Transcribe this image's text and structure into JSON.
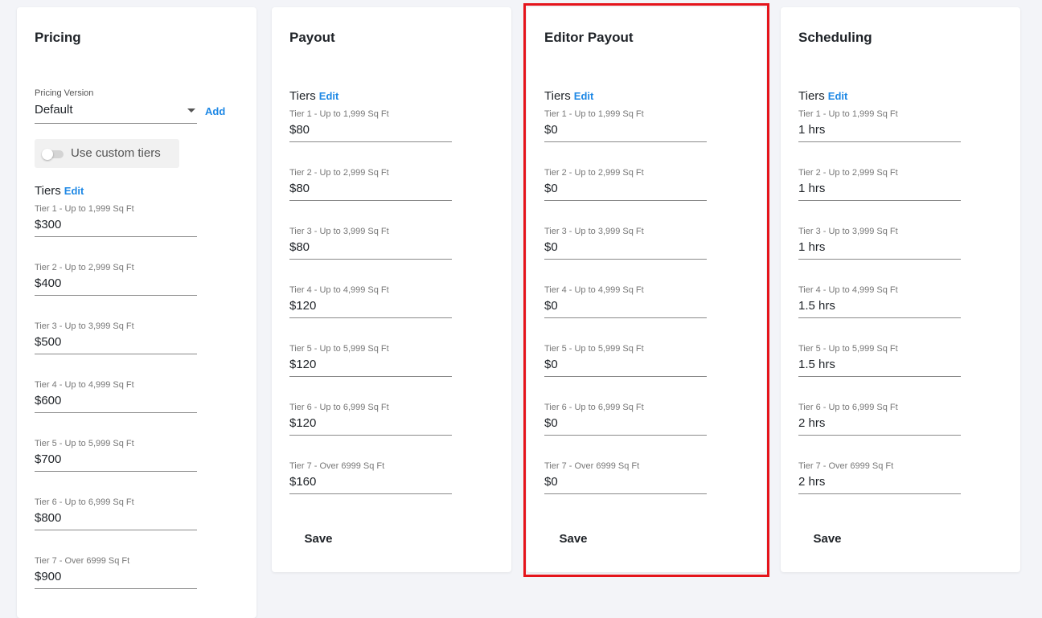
{
  "pricing": {
    "title": "Pricing",
    "version_label": "Pricing Version",
    "version_value": "Default",
    "add_label": "Add",
    "custom_tiers_label": "Use custom tiers",
    "tiers_label": "Tiers",
    "edit_label": "Edit",
    "tiers": [
      {
        "label": "Tier 1 - Up to 1,999 Sq Ft",
        "value": "$300"
      },
      {
        "label": "Tier 2 - Up to 2,999 Sq Ft",
        "value": "$400"
      },
      {
        "label": "Tier 3 - Up to 3,999 Sq Ft",
        "value": "$500"
      },
      {
        "label": "Tier 4 - Up to 4,999 Sq Ft",
        "value": "$600"
      },
      {
        "label": "Tier 5 - Up to 5,999 Sq Ft",
        "value": "$700"
      },
      {
        "label": "Tier 6 - Up to 6,999 Sq Ft",
        "value": "$800"
      },
      {
        "label": "Tier 7 - Over 6999 Sq Ft",
        "value": "$900"
      }
    ]
  },
  "payout": {
    "title": "Payout",
    "tiers_label": "Tiers",
    "edit_label": "Edit",
    "save_label": "Save",
    "tiers": [
      {
        "label": "Tier 1 - Up to 1,999 Sq Ft",
        "value": "$80"
      },
      {
        "label": "Tier 2 - Up to 2,999 Sq Ft",
        "value": "$80"
      },
      {
        "label": "Tier 3 - Up to 3,999 Sq Ft",
        "value": "$80"
      },
      {
        "label": "Tier 4 - Up to 4,999 Sq Ft",
        "value": "$120"
      },
      {
        "label": "Tier 5 - Up to 5,999 Sq Ft",
        "value": "$120"
      },
      {
        "label": "Tier 6 - Up to 6,999 Sq Ft",
        "value": "$120"
      },
      {
        "label": "Tier 7 - Over 6999 Sq Ft",
        "value": "$160"
      }
    ]
  },
  "editor_payout": {
    "title": "Editor Payout",
    "tiers_label": "Tiers",
    "edit_label": "Edit",
    "save_label": "Save",
    "tiers": [
      {
        "label": "Tier 1 - Up to 1,999 Sq Ft",
        "value": "$0"
      },
      {
        "label": "Tier 2 - Up to 2,999 Sq Ft",
        "value": "$0"
      },
      {
        "label": "Tier 3 - Up to 3,999 Sq Ft",
        "value": "$0"
      },
      {
        "label": "Tier 4 - Up to 4,999 Sq Ft",
        "value": "$0"
      },
      {
        "label": "Tier 5 - Up to 5,999 Sq Ft",
        "value": "$0"
      },
      {
        "label": "Tier 6 - Up to 6,999 Sq Ft",
        "value": "$0"
      },
      {
        "label": "Tier 7 - Over 6999 Sq Ft",
        "value": "$0"
      }
    ]
  },
  "scheduling": {
    "title": "Scheduling",
    "tiers_label": "Tiers",
    "edit_label": "Edit",
    "save_label": "Save",
    "tiers": [
      {
        "label": "Tier 1 - Up to 1,999 Sq Ft",
        "value": "1 hrs"
      },
      {
        "label": "Tier 2 - Up to 2,999 Sq Ft",
        "value": "1 hrs"
      },
      {
        "label": "Tier 3 - Up to 3,999 Sq Ft",
        "value": "1 hrs"
      },
      {
        "label": "Tier 4 - Up to 4,999 Sq Ft",
        "value": "1.5 hrs"
      },
      {
        "label": "Tier 5 - Up to 5,999 Sq Ft",
        "value": "1.5 hrs"
      },
      {
        "label": "Tier 6 - Up to 6,999 Sq Ft",
        "value": "2 hrs"
      },
      {
        "label": "Tier 7 - Over 6999 Sq Ft",
        "value": "2 hrs"
      }
    ]
  },
  "colors": {
    "accent": "#1e88e5",
    "highlight": "#e5141b",
    "background": "#f3f4f8",
    "card": "#ffffff"
  }
}
